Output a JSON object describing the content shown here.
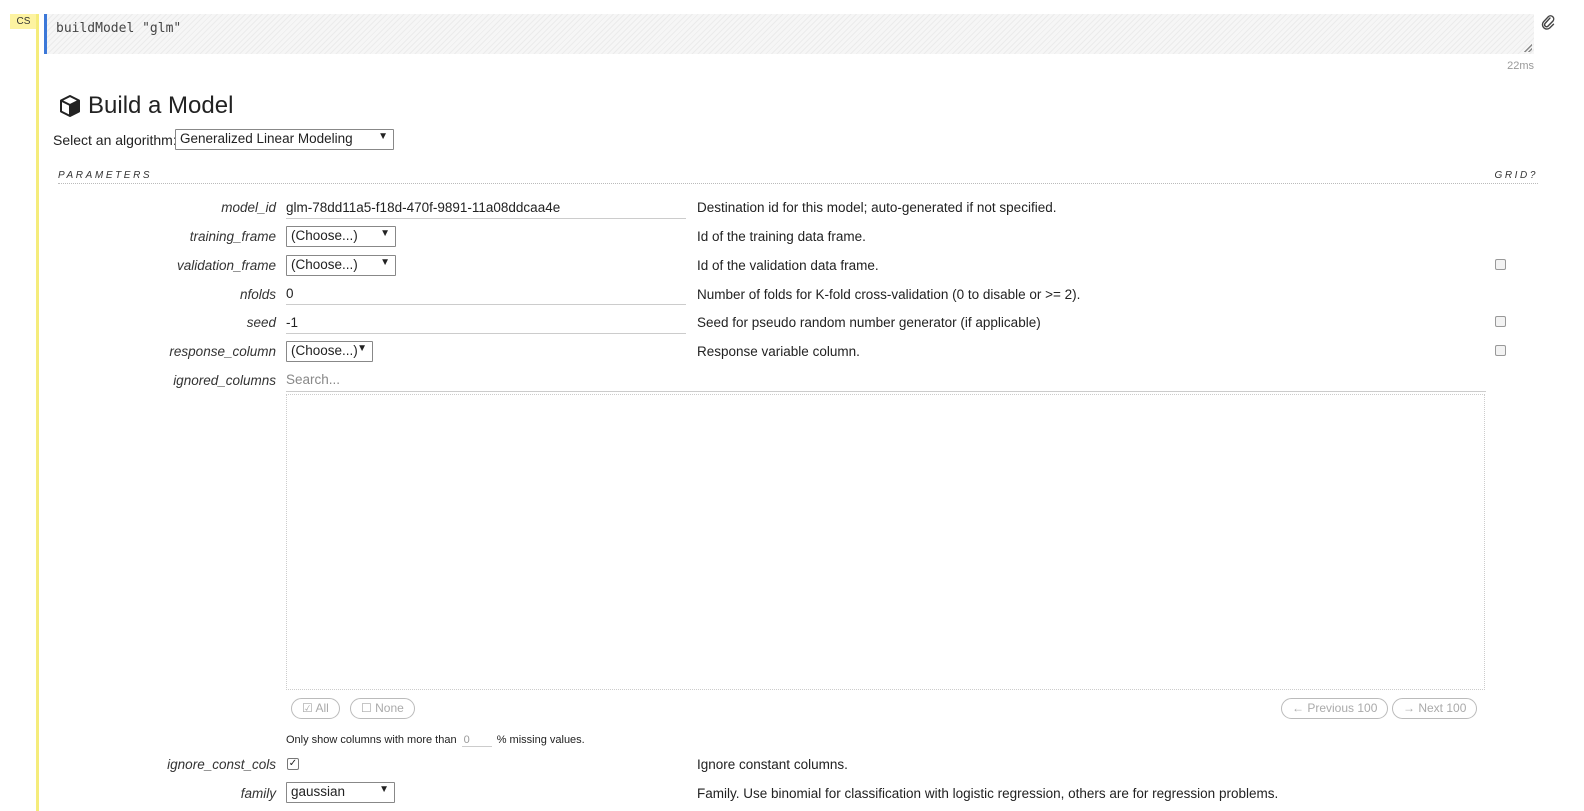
{
  "cell": {
    "badge": "CS",
    "code": "buildModel \"glm\"",
    "elapsed": "22ms"
  },
  "header": {
    "title": "Build a Model",
    "title_icon": "cube-icon",
    "algo_label": "Select an algorithm:",
    "algo_value": "Generalized Linear Modeling"
  },
  "parameters": {
    "section_label": "PARAMETERS",
    "grid_label": "GRID?",
    "model_id": {
      "label": "model_id",
      "value": "glm-78dd11a5-f18d-470f-9891-11a08ddcaa4e",
      "desc": "Destination id for this model; auto-generated if not specified."
    },
    "training_frame": {
      "label": "training_frame",
      "value": "(Choose...)",
      "desc": "Id of the training data frame."
    },
    "validation_frame": {
      "label": "validation_frame",
      "value": "(Choose...)",
      "desc": "Id of the validation data frame."
    },
    "nfolds": {
      "label": "nfolds",
      "value": "0",
      "desc": "Number of folds for K-fold cross-validation (0 to disable or >= 2)."
    },
    "seed": {
      "label": "seed",
      "value": "-1",
      "desc": "Seed for pseudo random number generator (if applicable)"
    },
    "response_column": {
      "label": "response_column",
      "value": "(Choose...)",
      "desc": "Response variable column."
    },
    "ignored_columns": {
      "label": "ignored_columns",
      "placeholder": "Search...",
      "all_label": "All",
      "none_label": "None",
      "prev_label": "Previous 100",
      "next_label": "Next 100",
      "missing_prefix": "Only show columns with more than",
      "missing_value": "0",
      "missing_suffix": "% missing values."
    },
    "ignore_const_cols": {
      "label": "ignore_const_cols",
      "checked": true,
      "desc": "Ignore constant columns."
    },
    "family": {
      "label": "family",
      "value": "gaussian",
      "desc": "Family. Use binomial for classification with logistic regression, others are for regression problems."
    }
  }
}
